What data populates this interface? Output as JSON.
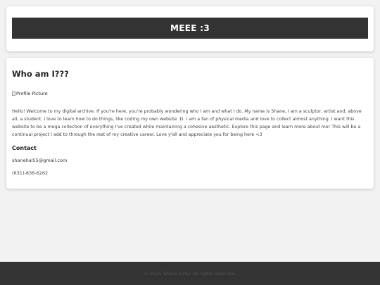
{
  "header": {
    "title": "MEEE :3"
  },
  "about": {
    "heading": "Who am I???",
    "profile_picture_alt": "Profile Picture",
    "bio": "Hello! Welcome to my digital archive. If you're here, you're probably wondering who I am and what I do. My name is Shane, I am a sculptor, artist and, above all, a student. I love to learn how to do things, like coding my own website :D. I am a fan of physical media and love to collect almost anything. I want this website to be a mega collection of everything I've created while maintaining a cohesive aesthetic. Explore this page and learn more about me! This will be a continual project I add to through the rest of my creative career. Love y'all and appreciate you for being here <3"
  },
  "contact": {
    "heading": "Contact",
    "email": "shanehal55@gmail.com",
    "phone": "(631)-836-6262"
  },
  "footer": {
    "text": "© 2025 Shane Kirby. All rights reserved."
  },
  "colors": {
    "page_background": "#f2f2f2",
    "card_background": "#ffffff",
    "title_bar": "#333333",
    "footer_background": "#333333"
  }
}
